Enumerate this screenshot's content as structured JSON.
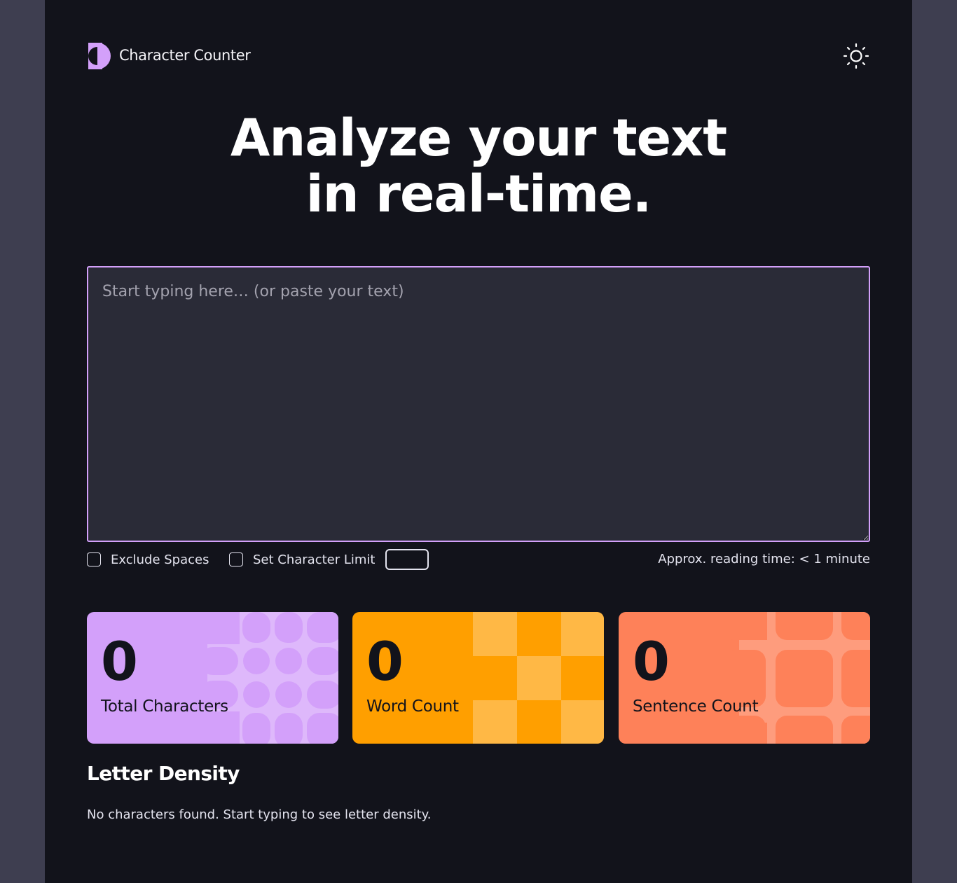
{
  "header": {
    "app_title": "Character Counter",
    "logo_icon": "half-circle-logo",
    "theme_toggle_icon": "sun-icon"
  },
  "hero": {
    "line1": "Analyze your text",
    "line2": "in real-time."
  },
  "text_input": {
    "value": "",
    "placeholder": "Start typing here… (or paste your text)"
  },
  "options": {
    "exclude_spaces_label": "Exclude Spaces",
    "exclude_spaces_checked": false,
    "set_limit_label": "Set Character Limit",
    "set_limit_checked": false,
    "limit_value": "",
    "reading_time": "Approx. reading time: < 1 minute"
  },
  "stats": [
    {
      "value": "0",
      "label": "Total Characters",
      "color": "#d3a0fa"
    },
    {
      "value": "0",
      "label": "Word Count",
      "color": "#ff9f00"
    },
    {
      "value": "0",
      "label": "Sentence Count",
      "color": "#fe8159"
    }
  ],
  "letter_density": {
    "title": "Letter Density",
    "empty_message": "No characters found. Start typing to see letter density."
  },
  "colors": {
    "background": "#12131b",
    "accent": "#d3a0fa",
    "textarea_bg": "#2a2b37"
  }
}
